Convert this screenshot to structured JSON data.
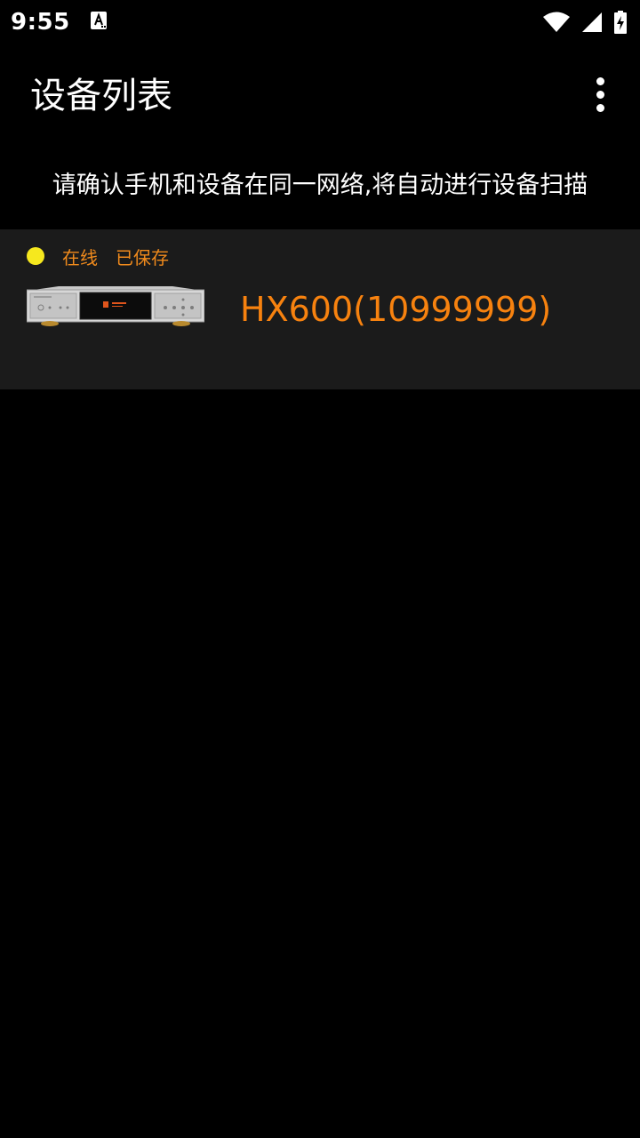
{
  "status_bar": {
    "time": "9:55",
    "icons": [
      "a-notification-icon",
      "wifi-icon",
      "signal-icon",
      "battery-charging-icon"
    ]
  },
  "app_bar": {
    "title": "设备列表",
    "menu_icon": "more-vert-icon"
  },
  "hint": "请确认手机和设备在同一网络,将自动进行设备扫描",
  "devices": [
    {
      "status_online": "在线",
      "status_saved": "已保存",
      "name": "HX600(10999999)",
      "indicator_color": "#f6e81e"
    }
  ],
  "colors": {
    "background": "#000000",
    "card": "#1b1b1b",
    "accent_orange": "#f7820f",
    "status_yellow": "#f6e81e"
  }
}
